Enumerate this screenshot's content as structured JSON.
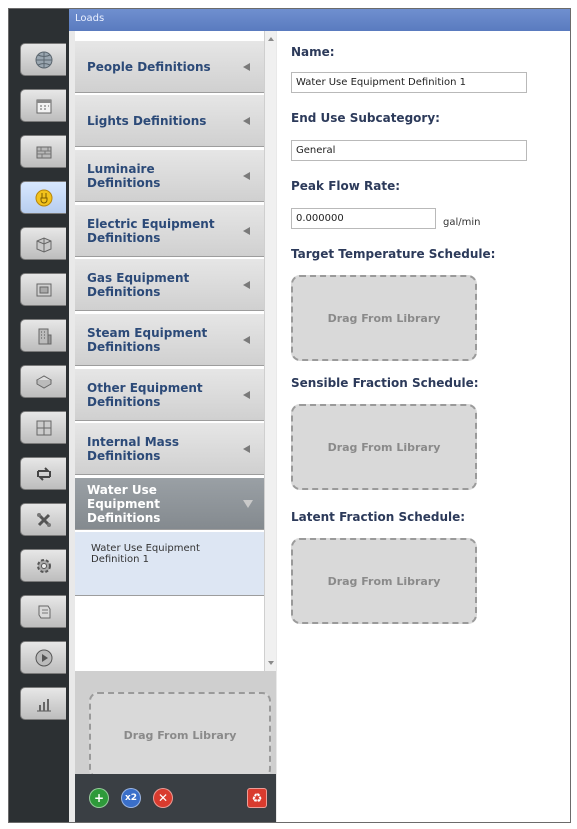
{
  "window": {
    "title": "Loads"
  },
  "rail": {
    "items": [
      {
        "icon": "globe-icon"
      },
      {
        "icon": "calendar-icon"
      },
      {
        "icon": "constructions-icon"
      },
      {
        "icon": "loads-icon",
        "active": true
      },
      {
        "icon": "space-types-icon"
      },
      {
        "icon": "geometry-icon"
      },
      {
        "icon": "facility-icon"
      },
      {
        "icon": "spaces-icon"
      },
      {
        "icon": "thermal-zones-icon"
      },
      {
        "icon": "hvac-systems-icon"
      },
      {
        "icon": "variables-icon"
      },
      {
        "icon": "simulation-settings-icon"
      },
      {
        "icon": "scripts-icon"
      },
      {
        "icon": "run-simulation-icon"
      },
      {
        "icon": "results-icon"
      }
    ]
  },
  "categories": [
    {
      "label": "People Definitions"
    },
    {
      "label": "Lights Definitions"
    },
    {
      "label": "Luminaire Definitions"
    },
    {
      "label": "Electric Equipment Definitions"
    },
    {
      "label": "Gas Equipment Definitions"
    },
    {
      "label": "Steam Equipment Definitions"
    },
    {
      "label": "Other Equipment Definitions"
    },
    {
      "label": "Internal Mass Definitions"
    },
    {
      "label": "Water Use Equipment Definitions",
      "selected": true
    }
  ],
  "selected_item": {
    "label": "Water Use Equipment Definition 1"
  },
  "list_drop": {
    "label": "Drag From Library"
  },
  "bottom_buttons": [
    {
      "name": "add-button",
      "glyph": "+",
      "color": "#2e9a3a"
    },
    {
      "name": "copy-button",
      "glyph": "x2",
      "color": "#3a6fc9"
    },
    {
      "name": "remove-button",
      "glyph": "✕",
      "color": "#d93b2e"
    },
    {
      "name": "purge-button",
      "glyph": "♻",
      "color": "#d93b2e"
    }
  ],
  "detail": {
    "name_label": "Name:",
    "name_value": "Water Use Equipment Definition 1",
    "end_use_label": "End Use Subcategory:",
    "end_use_value": "General",
    "peak_flow_label": "Peak Flow Rate:",
    "peak_flow_value": "0.000000",
    "peak_flow_unit": "gal/min",
    "target_temp_label": "Target Temperature Schedule:",
    "target_temp_drop": "Drag From Library",
    "sensible_label": "Sensible Fraction Schedule:",
    "sensible_drop": "Drag From Library",
    "latent_label": "Latent Fraction Schedule:",
    "latent_drop": "Drag From Library"
  },
  "colors": {
    "title_bar": "#5a7bbf",
    "rail": "#2c3033",
    "label_blue": "#2c4a78",
    "selected_category": "#8a9095",
    "selected_item_bg": "#dde6f3"
  }
}
